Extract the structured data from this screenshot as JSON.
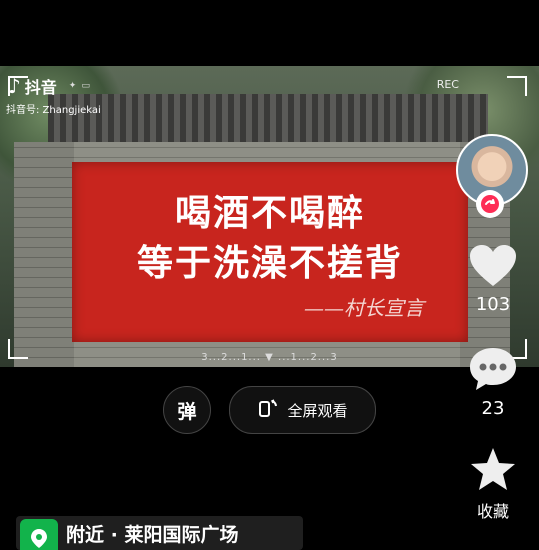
{
  "app": {
    "logo_text": "抖音",
    "account_label": "抖音号: Zhangjiekai"
  },
  "video": {
    "slogan_line1": "喝酒不喝醉",
    "slogan_line2": "等于洗澡不搓背",
    "signature": "——村长宣言",
    "rec_label": "REC",
    "countdown": "3...2...1... ▼ ...1...2...3"
  },
  "controls": {
    "danmu_label": "弹",
    "fullscreen_label": "全屏观看"
  },
  "sidebar": {
    "likes": "103",
    "comments": "23",
    "favorite_label": "收藏"
  },
  "location": {
    "label": "附近 · 莱阳国际广场"
  },
  "colors": {
    "banner": "#c8251e",
    "location_green": "#12b34b"
  },
  "icons": [
    "tiktok-icon",
    "heart-icon",
    "comment-icon",
    "star-icon",
    "fullscreen-icon",
    "location-icon",
    "follow-icon"
  ]
}
